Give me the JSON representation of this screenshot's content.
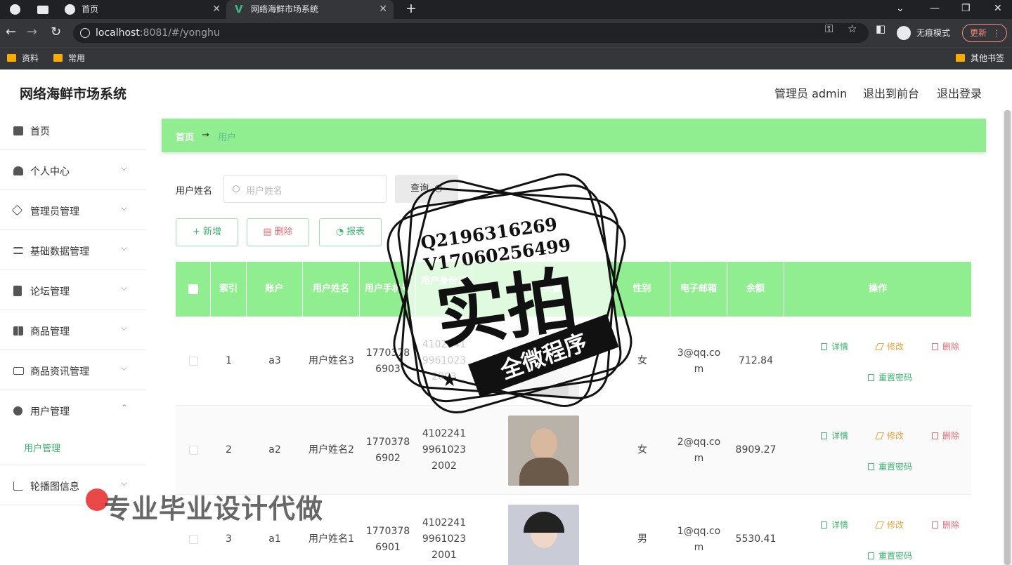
{
  "browser": {
    "tabs": [
      {
        "label": ""
      },
      {
        "label": "首页"
      },
      {
        "label": "网络海鲜市场系统"
      }
    ],
    "url_host": "localhost",
    "url_rest": ":8081/#/yonghu",
    "incognito_label": "无痕模式",
    "update_label": "更新",
    "bookmarks": [
      "资料",
      "常用"
    ],
    "other_bookmarks": "其他书签"
  },
  "app": {
    "title": "网络海鲜市场系统",
    "topnav": [
      "管理员 admin",
      "退出到前台",
      "退出登录"
    ]
  },
  "sidebar": {
    "items": [
      {
        "label": "首页",
        "icon": "home-icon"
      },
      {
        "label": "个人中心",
        "icon": "user-icon"
      },
      {
        "label": "管理员管理",
        "icon": "send-icon"
      },
      {
        "label": "基础数据管理",
        "icon": "sliders-icon"
      },
      {
        "label": "论坛管理",
        "icon": "clipboard-icon"
      },
      {
        "label": "商品管理",
        "icon": "grid-icon"
      },
      {
        "label": "商品资讯管理",
        "icon": "mail-icon"
      },
      {
        "label": "用户管理",
        "icon": "chat-icon"
      },
      {
        "label": "轮播图信息",
        "icon": "crop-icon"
      }
    ],
    "subitem": "用户管理"
  },
  "breadcrumb": {
    "home": "首页",
    "sep": "→",
    "current": "用户"
  },
  "search": {
    "label": "用户姓名",
    "placeholder": "用户姓名",
    "query_label": "查询"
  },
  "actions": {
    "add": "新增",
    "delete": "删除",
    "report": "报表"
  },
  "table": {
    "headers": [
      "索引",
      "账户",
      "用户姓名",
      "用户手机号",
      "用户身份证号",
      "用户头像",
      "性别",
      "电子邮箱",
      "余额",
      "操作"
    ],
    "rows": [
      {
        "index": "1",
        "account": "a3",
        "name": "用户姓名3",
        "phone": "17703786903",
        "idcard": "410224199610232003",
        "gender": "女",
        "email": "3@qq.com",
        "balance": "712.84"
      },
      {
        "index": "2",
        "account": "a2",
        "name": "用户姓名2",
        "phone": "17703786902",
        "idcard": "410224199610232002",
        "gender": "女",
        "email": "2@qq.com",
        "balance": "8909.27"
      },
      {
        "index": "3",
        "account": "a1",
        "name": "用户姓名1",
        "phone": "17703786901",
        "idcard": "410224199610232001",
        "gender": "男",
        "email": "1@qq.com",
        "balance": "5530.41"
      }
    ],
    "ops": {
      "detail": "详情",
      "edit": "修改",
      "delete": "删除",
      "reset": "重置密码"
    }
  },
  "watermark": {
    "qq": "Q2196316269",
    "vx": "V17060256499",
    "big": "实拍",
    "banner": "全微程序",
    "bottom": "专业毕业设计代做"
  },
  "colors": {
    "accent": "#90ee90",
    "link": "#3cb371",
    "danger": "#e06c75",
    "warning": "#e6a23c"
  }
}
